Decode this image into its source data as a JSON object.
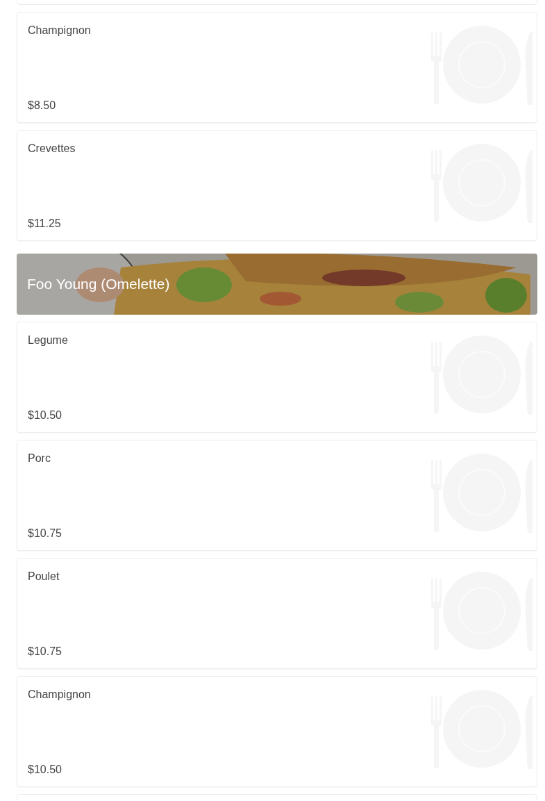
{
  "sections": [
    {
      "items": [
        {
          "name": "Champignon",
          "price": "$8.50"
        },
        {
          "name": "Crevettes",
          "price": "$11.25"
        }
      ]
    },
    {
      "title": "Foo Young (Omelette)",
      "kind": "picture",
      "items": [
        {
          "name": "Legume",
          "price": "$10.50"
        },
        {
          "name": "Porc",
          "price": "$10.75"
        },
        {
          "name": "Poulet",
          "price": "$10.75"
        },
        {
          "name": "Champignon",
          "price": "$10.50"
        }
      ]
    }
  ]
}
